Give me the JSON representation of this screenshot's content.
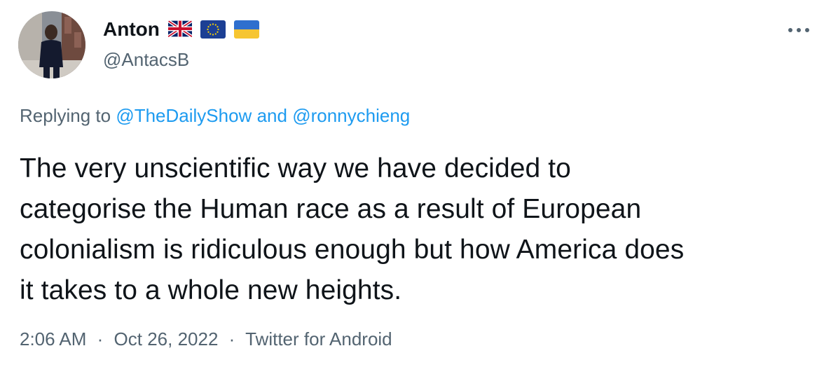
{
  "author": {
    "display_name": "Anton",
    "handle": "@AntacsB",
    "flags": [
      "uk-flag-icon",
      "eu-flag-icon",
      "ukraine-flag-icon"
    ]
  },
  "more_icon": "more-horizontal-icon",
  "reply_context": {
    "prefix": "Replying to",
    "mention_1": "@TheDailyShow",
    "joiner": "and",
    "mention_2": "@ronnychieng"
  },
  "tweet": {
    "text_lines": [
      "The very unscientific way we have decided to",
      "categorise the Human race as a result of European",
      "colonialism is ridiculous enough but how America does",
      "it takes to a whole new heights."
    ]
  },
  "meta": {
    "time": "2:06 AM",
    "separator": "·",
    "date": "Oct 26, 2022",
    "source": "Twitter for Android"
  },
  "colors": {
    "text": "#0f1419",
    "secondary": "#536471",
    "link": "#1d9bf0",
    "background": "#ffffff"
  }
}
